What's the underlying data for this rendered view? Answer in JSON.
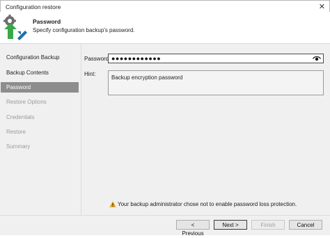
{
  "window": {
    "title": "Configuration restore",
    "close_glyph": "✕"
  },
  "header": {
    "title": "Password",
    "subtitle": "Specify configuration backup's password."
  },
  "sidebar": {
    "items": [
      {
        "label": "Configuration Backup",
        "state": "normal"
      },
      {
        "label": "Backup Contents",
        "state": "normal"
      },
      {
        "label": "Password",
        "state": "active"
      },
      {
        "label": "Restore Options",
        "state": "disabled"
      },
      {
        "label": "Credentials",
        "state": "disabled"
      },
      {
        "label": "Restore",
        "state": "disabled"
      },
      {
        "label": "Summary",
        "state": "disabled"
      }
    ]
  },
  "form": {
    "password_label": "Password:",
    "password_value": "●●●●●●●●●●●●",
    "hint_label": "Hint:",
    "hint_value": "Backup encryption password"
  },
  "warning": {
    "text": "Your backup administrator chose not to enable password loss protection."
  },
  "buttons": {
    "previous": "< Previous",
    "next": "Next >",
    "finish": "Finish",
    "cancel": "Cancel"
  },
  "colors": {
    "active_item": "#8d8d8d",
    "panel_bg": "#f0f0f0",
    "logo_green": "#3aa84a",
    "logo_blue": "#1f6fa8",
    "warning": "#e8a317"
  },
  "icons": {
    "logo": "veeam-restore-icon",
    "eye": "eye-icon",
    "warning": "warning-icon"
  }
}
